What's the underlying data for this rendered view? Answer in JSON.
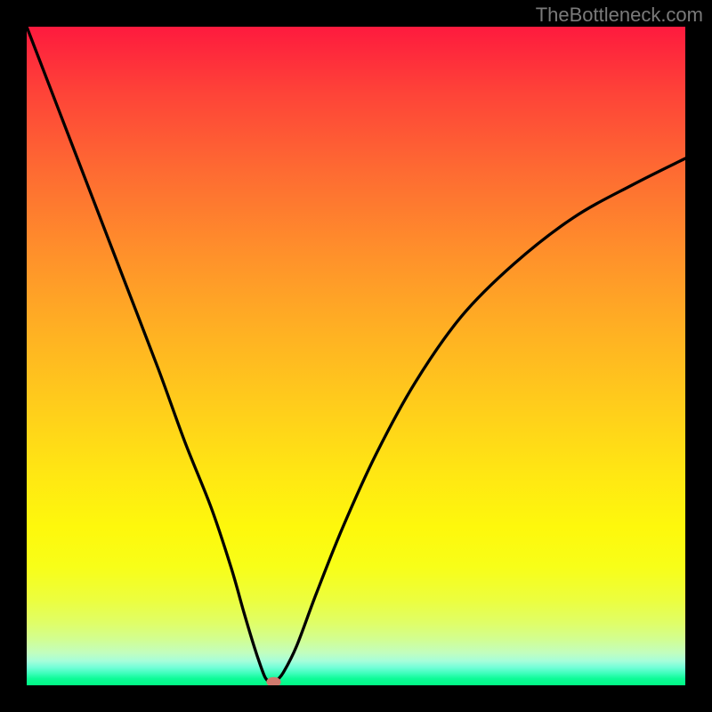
{
  "watermark": "TheBottleneck.com",
  "chart_data": {
    "type": "line",
    "title": "",
    "xlabel": "",
    "ylabel": "",
    "xlim": [
      0,
      100
    ],
    "ylim": [
      0,
      100
    ],
    "grid": false,
    "series": [
      {
        "name": "bottleneck-curve",
        "x": [
          0,
          5,
          10,
          15,
          20,
          24,
          28,
          31,
          33,
          34.5,
          35.5,
          36.2,
          36.8,
          37.2,
          38,
          39,
          41,
          44,
          48,
          53,
          59,
          66,
          74,
          83,
          92,
          100
        ],
        "values": [
          100,
          87,
          74,
          61,
          48,
          37,
          27,
          18,
          11,
          6,
          3,
          1.2,
          0.5,
          0.3,
          0.8,
          2,
          6,
          14,
          24,
          35,
          46,
          56,
          64,
          71,
          76,
          80
        ]
      }
    ],
    "marker": {
      "x": 37.5,
      "y": 0.5,
      "color": "#d07a6e"
    },
    "background_gradient": {
      "direction": "top-to-bottom",
      "stops": [
        {
          "pos": 0,
          "color": "#fe1a3e"
        },
        {
          "pos": 50,
          "color": "#ffb023"
        },
        {
          "pos": 78,
          "color": "#fef80c"
        },
        {
          "pos": 95,
          "color": "#c3febd"
        },
        {
          "pos": 100,
          "color": "#00f985"
        }
      ]
    }
  }
}
